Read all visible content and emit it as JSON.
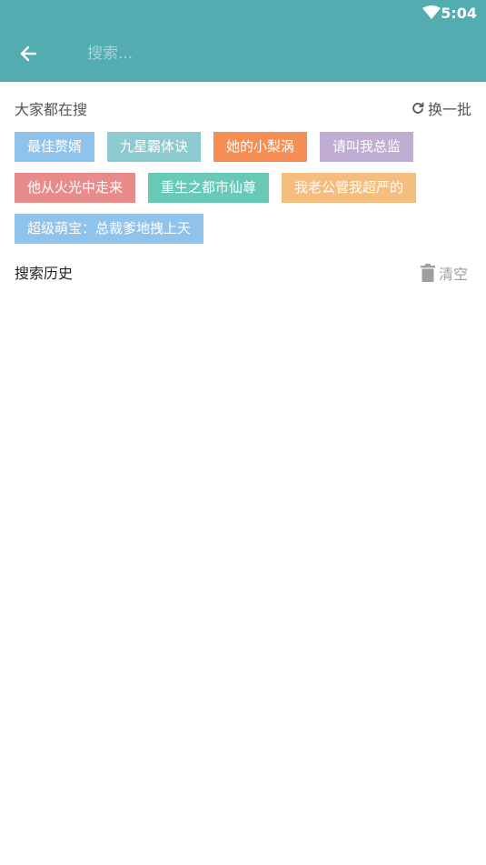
{
  "status": {
    "time": "5:04"
  },
  "header": {
    "search_placeholder": "搜索..."
  },
  "hot_searches": {
    "title": "大家都在搜",
    "refresh_label": "换一批",
    "tags": [
      {
        "label": "最佳赘婿",
        "color": "#90c3ec"
      },
      {
        "label": "九星霸体诀",
        "color": "#8ecbd0"
      },
      {
        "label": "她的小梨涡",
        "color": "#f58f53"
      },
      {
        "label": "请叫我总监",
        "color": "#c1acd4"
      },
      {
        "label": "他从火光中走来",
        "color": "#e88b8b"
      },
      {
        "label": "重生之都市仙尊",
        "color": "#68c9b7"
      },
      {
        "label": "我老公管我超严的",
        "color": "#f5bd7e"
      },
      {
        "label": "超级萌宝：总裁爹地拽上天",
        "color": "#90c3ec"
      }
    ]
  },
  "history": {
    "title": "搜索历史",
    "clear_label": "清空",
    "items": []
  }
}
